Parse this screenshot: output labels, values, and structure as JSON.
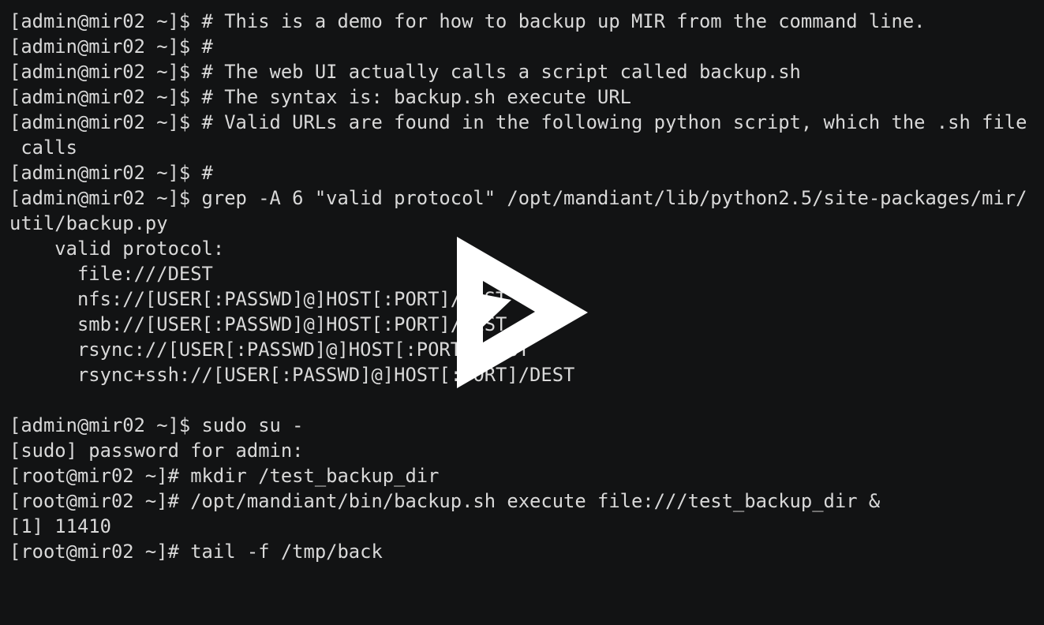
{
  "terminal": {
    "background_color": "#121314",
    "text_color": "#d9d9d9",
    "lines": [
      "[admin@mir02 ~]$ # This is a demo for how to backup up MIR from the command line.",
      "[admin@mir02 ~]$ #",
      "[admin@mir02 ~]$ # The web UI actually calls a script called backup.sh",
      "[admin@mir02 ~]$ # The syntax is: backup.sh execute URL",
      "[admin@mir02 ~]$ # Valid URLs are found in the following python script, which the .sh file",
      " calls",
      "[admin@mir02 ~]$ #",
      "[admin@mir02 ~]$ grep -A 6 \"valid protocol\" /opt/mandiant/lib/python2.5/site-packages/mir/",
      "util/backup.py",
      "    valid protocol:",
      "      file:///DEST",
      "      nfs://[USER[:PASSWD]@]HOST[:PORT]/DEST",
      "      smb://[USER[:PASSWD]@]HOST[:PORT]/DEST",
      "      rsync://[USER[:PASSWD]@]HOST[:PORT]/DEST",
      "      rsync+ssh://[USER[:PASSWD]@]HOST[:PORT]/DEST",
      "",
      "[admin@mir02 ~]$ sudo su -",
      "[sudo] password for admin:",
      "[root@mir02 ~]# mkdir /test_backup_dir",
      "[root@mir02 ~]# /opt/mandiant/bin/backup.sh execute file:///test_backup_dir &",
      "[1] 11410",
      "[root@mir02 ~]# tail -f /tmp/back"
    ]
  },
  "overlay": {
    "icon": "play-icon",
    "color": "#ffffff"
  }
}
